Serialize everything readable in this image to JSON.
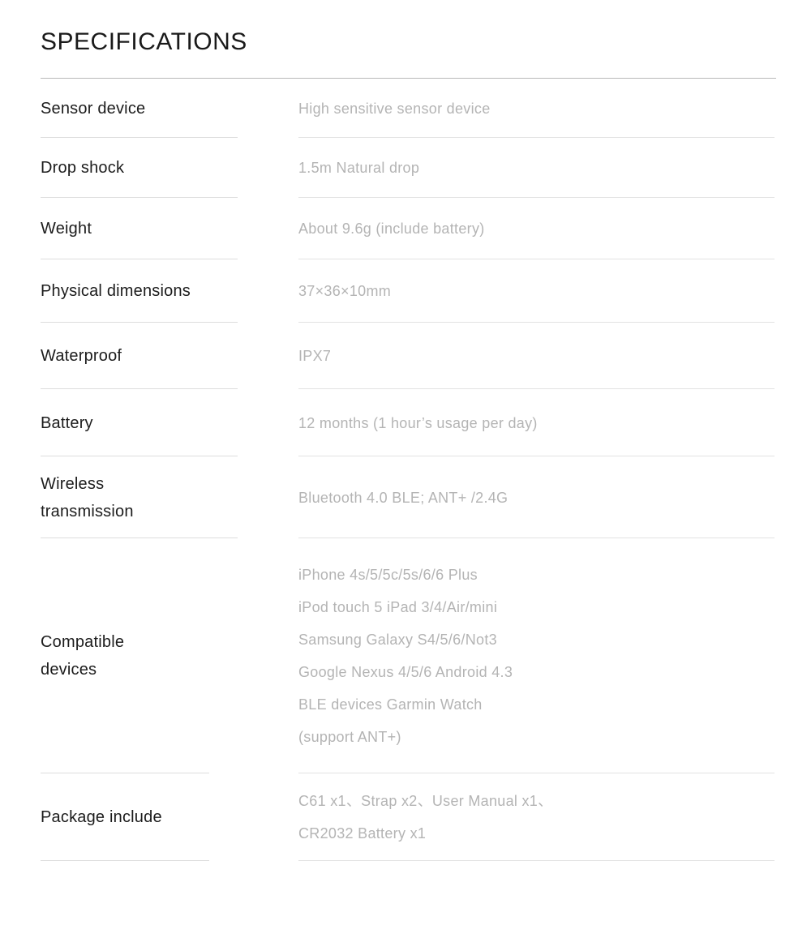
{
  "page": {
    "title": "SPECIFICATIONS",
    "background_color": "#ffffff",
    "label_color": "#1c1c1c",
    "value_color": "#b4b4b4",
    "rule_color": "#dddddd",
    "title_rule_color": "#b9b9b9"
  },
  "rows": [
    {
      "label": "Sensor device",
      "value": "High sensitive sensor device"
    },
    {
      "label": "Drop shock",
      "value": "1.5m Natural drop"
    },
    {
      "label": "Weight",
      "value": "About 9.6g (include battery)"
    },
    {
      "label": "Physical dimensions",
      "value": "37×36×10mm"
    },
    {
      "label": "Waterproof",
      "value": "IPX7"
    },
    {
      "label": "Battery",
      "value": "12 months (1 hour’s usage per day)"
    },
    {
      "label_line1": "Wireless",
      "label_line2": "transmission",
      "value": "Bluetooth 4.0 BLE; ANT+ /2.4G"
    },
    {
      "label_line1": "Compatible",
      "label_line2": "devices",
      "value_line1": "iPhone 4s/5/5c/5s/6/6 Plus",
      "value_line2": "iPod touch 5 iPad 3/4/Air/mini",
      "value_line3": "Samsung Galaxy S4/5/6/Not3",
      "value_line4": "Google Nexus 4/5/6 Android 4.3",
      "value_line5": "BLE devices Garmin Watch",
      "value_line6": "(support ANT+)"
    },
    {
      "label": "Package include",
      "value_line1": "C61 x1、Strap x2、User Manual x1、",
      "value_line2": "CR2032 Battery x1"
    }
  ]
}
